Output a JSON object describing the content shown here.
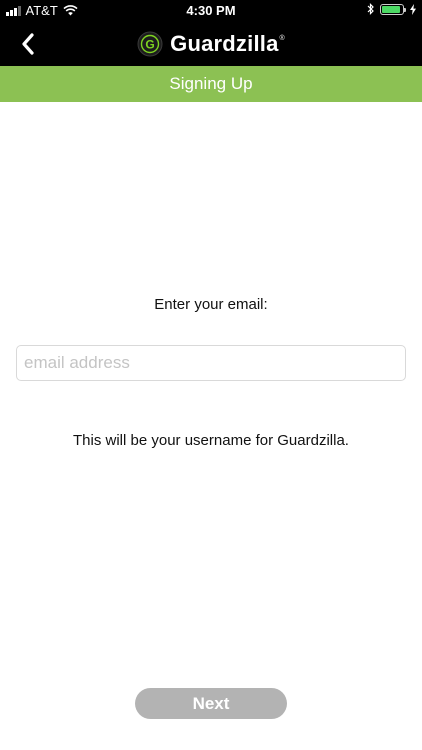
{
  "status_bar": {
    "carrier": "AT&T",
    "time": "4:30 PM",
    "icons": [
      "signal-bars-icon",
      "wifi-icon",
      "bluetooth-icon",
      "battery-icon",
      "charging-bolt-icon"
    ]
  },
  "nav": {
    "back_icon": "chevron-left-icon",
    "brand_name": "Guardzilla",
    "brand_mark": "®",
    "logo_letter": "G"
  },
  "section": {
    "title": "Signing Up"
  },
  "form": {
    "prompt": "Enter your email:",
    "email_placeholder": "email address",
    "email_value": "",
    "hint": "This will be your username for Guardzilla."
  },
  "actions": {
    "next_label": "Next"
  },
  "colors": {
    "header_bg": "#000000",
    "section_bar": "#8cc153",
    "button_disabled": "#b3b3b3",
    "logo_green": "#7ed321"
  }
}
